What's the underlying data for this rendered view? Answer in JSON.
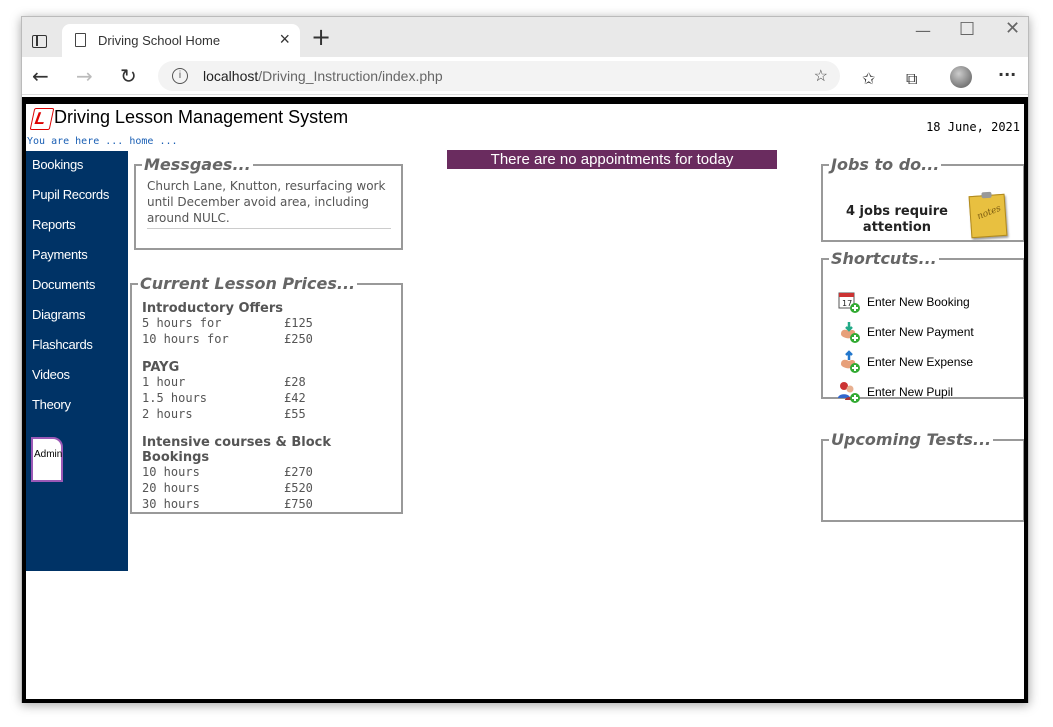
{
  "browser": {
    "tab_title": "Driving School Home",
    "url_host": "localhost",
    "url_path": "/Driving_Instruction/index.php"
  },
  "site": {
    "title": "Driving Lesson Management System",
    "date": "18 June, 2021",
    "breadcrumb": "You are here ... home ..."
  },
  "nav": {
    "items": [
      "Bookings",
      "Pupil Records",
      "Reports",
      "Payments",
      "Documents",
      "Diagrams",
      "Flashcards",
      "Videos",
      "Theory"
    ],
    "admin_label": "Admin"
  },
  "messages": {
    "legend": "Messgaes...",
    "text": "Church Lane, Knutton, resurfacing work until December avoid area, including around NULC."
  },
  "banner": "There are no appointments for today",
  "prices": {
    "legend": "Current Lesson Prices...",
    "groups": [
      {
        "title": "Introductory Offers",
        "rows": [
          [
            "5 hours for",
            "£125"
          ],
          [
            "10 hours for",
            "£250"
          ]
        ]
      },
      {
        "title": "PAYG",
        "rows": [
          [
            "1 hour",
            "£28"
          ],
          [
            "1.5 hours",
            "£42"
          ],
          [
            "2 hours",
            "£55"
          ]
        ]
      },
      {
        "title": "Intensive courses & Block Bookings",
        "rows": [
          [
            "10 hours",
            "£270"
          ],
          [
            "20 hours",
            "£520"
          ],
          [
            "30 hours",
            "£750"
          ]
        ]
      }
    ]
  },
  "jobs": {
    "legend": "Jobs to do...",
    "text": "4 jobs require attention",
    "notes_label": "notes"
  },
  "shortcuts": {
    "legend": "Shortcuts...",
    "items": [
      "Enter New Booking",
      "Enter New Payment",
      "Enter New Expense",
      "Enter New Pupil"
    ]
  },
  "tests": {
    "legend": "Upcoming Tests..."
  },
  "colors": {
    "nav_bg": "#003366",
    "banner_bg": "#6a2c5f",
    "legend_text": "#666666",
    "admin_border": "#9b59b6"
  }
}
